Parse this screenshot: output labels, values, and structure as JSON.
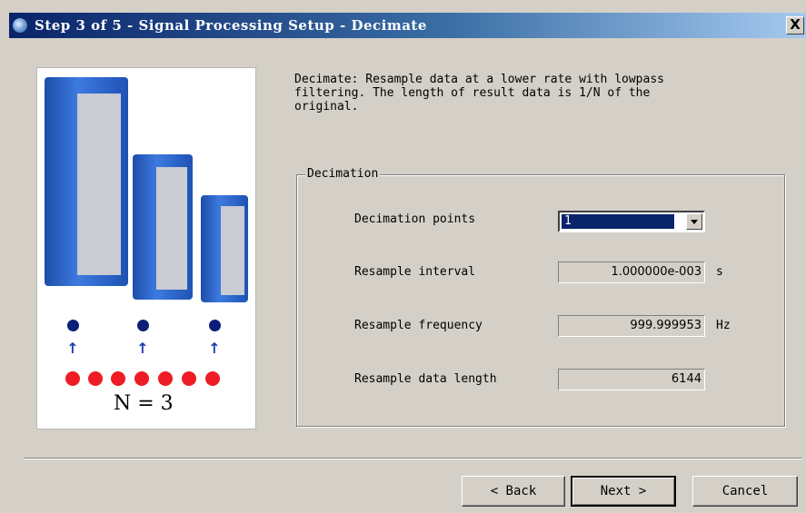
{
  "window": {
    "title": "Step 3 of 5 - Signal Processing Setup - Decimate",
    "app_icon": "app-globe-icon",
    "close_label": "X"
  },
  "illustration": {
    "caption": "N = 3",
    "colors": {
      "sample_dot": "#ee1c24",
      "kept_dot": "#0a1e78",
      "device": "#1f52b5"
    }
  },
  "description": "Decimate: Resample data at a lower rate with lowpass\nfiltering. The length of result data is 1/N of the\noriginal.",
  "decimation": {
    "group_label": "Decimation",
    "points": {
      "label": "Decimation points",
      "value": "1"
    },
    "interval": {
      "label": "Resample interval",
      "value": "1.000000e-003",
      "unit": "s"
    },
    "frequency": {
      "label": "Resample frequency",
      "value": "999.999953",
      "unit": "Hz"
    },
    "length": {
      "label": "Resample data length",
      "value": "6144"
    }
  },
  "buttons": {
    "back": "< Back",
    "next": "Next >",
    "cancel": "Cancel"
  }
}
